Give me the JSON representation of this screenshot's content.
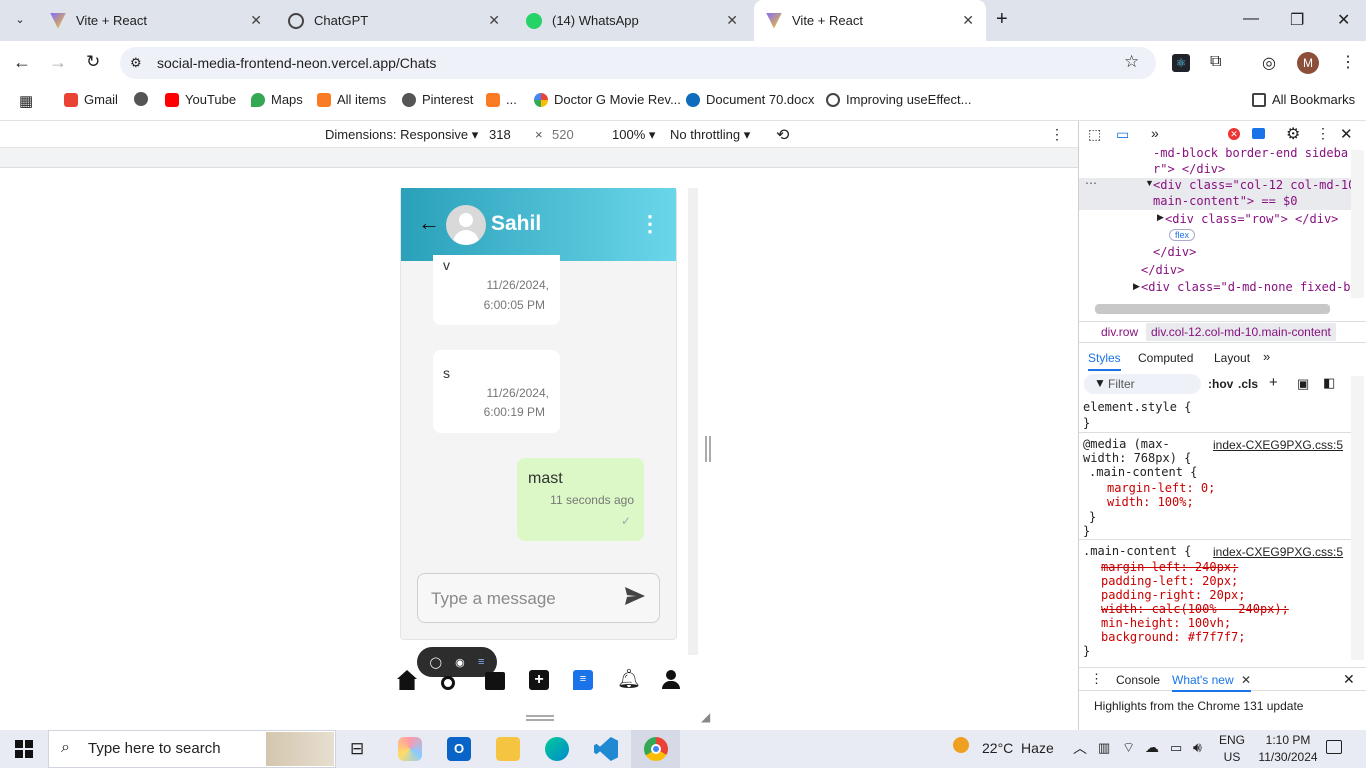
{
  "tabs": [
    {
      "title": "Vite + React",
      "active": false
    },
    {
      "title": "ChatGPT",
      "active": false
    },
    {
      "title": "(14) WhatsApp",
      "active": false
    },
    {
      "title": "Vite + React",
      "active": true
    }
  ],
  "address": {
    "url": "social-media-frontend-neon.vercel.app/Chats"
  },
  "profile_initial": "M",
  "bookmarks": [
    "Gmail",
    "YouTube",
    "Maps",
    "All items",
    "Pinterest",
    "...",
    "Doctor G Movie Rev...",
    "Document 70.docx",
    "Improving useEffect..."
  ],
  "all_bookmarks": "All Bookmarks",
  "device_toolbar": {
    "dimensions": "Dimensions: Responsive",
    "width": "318",
    "height": "520",
    "zoom": "100%",
    "throttling": "No throttling"
  },
  "chat": {
    "contact": "Sahil",
    "messages": [
      {
        "text": "v",
        "time1": "11/26/2024,",
        "time2": "6:00:05 PM",
        "own": false
      },
      {
        "text": "s",
        "time1": "11/26/2024,",
        "time2": "6:00:19 PM",
        "own": false
      },
      {
        "text": "mast",
        "time1": "11 seconds ago",
        "time2": "",
        "own": true
      }
    ],
    "input_placeholder": "Type a message"
  },
  "devtools": {
    "elements": [
      "-md-block border-end sideba",
      "r\"> </div>",
      "<div class=\"col-12 col-md-10",
      "main-content\"> == $0",
      "<div class=\"row\"> </div>",
      "flex",
      "</div>",
      "</div>",
      "<div class=\"d-md-none fixed-bot"
    ],
    "breadcrumbs": [
      "div.row",
      "div.col-12.col-md-10.main-content"
    ],
    "tabs": [
      "Styles",
      "Computed",
      "Layout"
    ],
    "filter_placeholder": "Filter",
    "hov": ":hov",
    "cls": ".cls",
    "styles": [
      "element.style {",
      "}",
      "@media (max-",
      "width: 768px) {",
      ".main-content {",
      "margin-left: 0;",
      "width: 100%;",
      "}",
      "}",
      ".main-content {",
      "margin-left: 240px;",
      "padding-left: 20px;",
      "padding-right: 20px;",
      "width: calc(100% - 240px);",
      "min-height: 100vh;",
      "background: #f7f7f7;",
      "}"
    ],
    "source": "index-CXEG9PXG.css:5",
    "drawer_tabs": [
      "Console",
      "What's new"
    ],
    "drawer_text": "Highlights from the Chrome 131 update"
  },
  "taskbar": {
    "search_placeholder": "Type here to search",
    "weather": "22°C  Haze",
    "lang1": "ENG",
    "lang2": "US",
    "time": "1:10 PM",
    "date": "11/30/2024"
  },
  "colors": {
    "header_start": "#2aa0b9",
    "header_end": "#6ad6ea",
    "own_bubble": "#dcf8c6",
    "accent": "#1a73e8"
  }
}
